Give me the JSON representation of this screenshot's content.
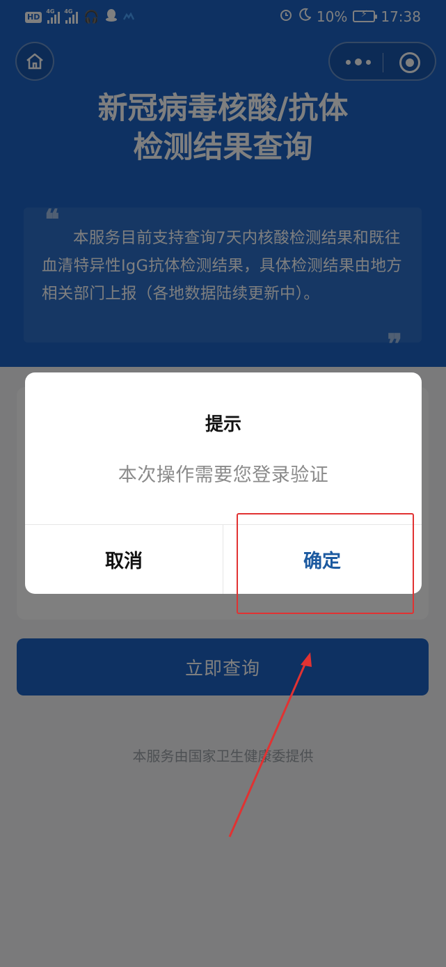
{
  "status_bar": {
    "left_badge": "HD",
    "net1": "4G",
    "net2": "4G",
    "battery_pct": "10%",
    "time": "17:38",
    "icons": [
      "headset-icon",
      "qq-icon",
      "bird-icon",
      "alarm-icon",
      "moon-icon",
      "battery-icon"
    ]
  },
  "nav": {
    "home_icon": "home-icon",
    "more_icon": "more-dots-icon",
    "close_icon": "target-circle-icon"
  },
  "hero": {
    "title_line1": "新冠病毒核酸/抗体",
    "title_line2": "检测结果查询",
    "notice_open_quote": "❝",
    "notice_text": "本服务目前支持查询7天内核酸检测结果和既往血清特异性IgG抗体检测结果，具体检测结果由地方相关部门上报（各地数据陆续更新中）。",
    "notice_close_quote": "❞"
  },
  "main": {
    "query_button": "立即查询",
    "provider": "本服务由国家卫生健康委提供"
  },
  "dialog": {
    "title": "提示",
    "message": "本次操作需要您登录验证",
    "cancel": "取消",
    "confirm": "确定"
  },
  "colors": {
    "brand_blue": "#1c63c4",
    "confirm_text": "#1c5aa0",
    "annotation_red": "#e13232"
  }
}
